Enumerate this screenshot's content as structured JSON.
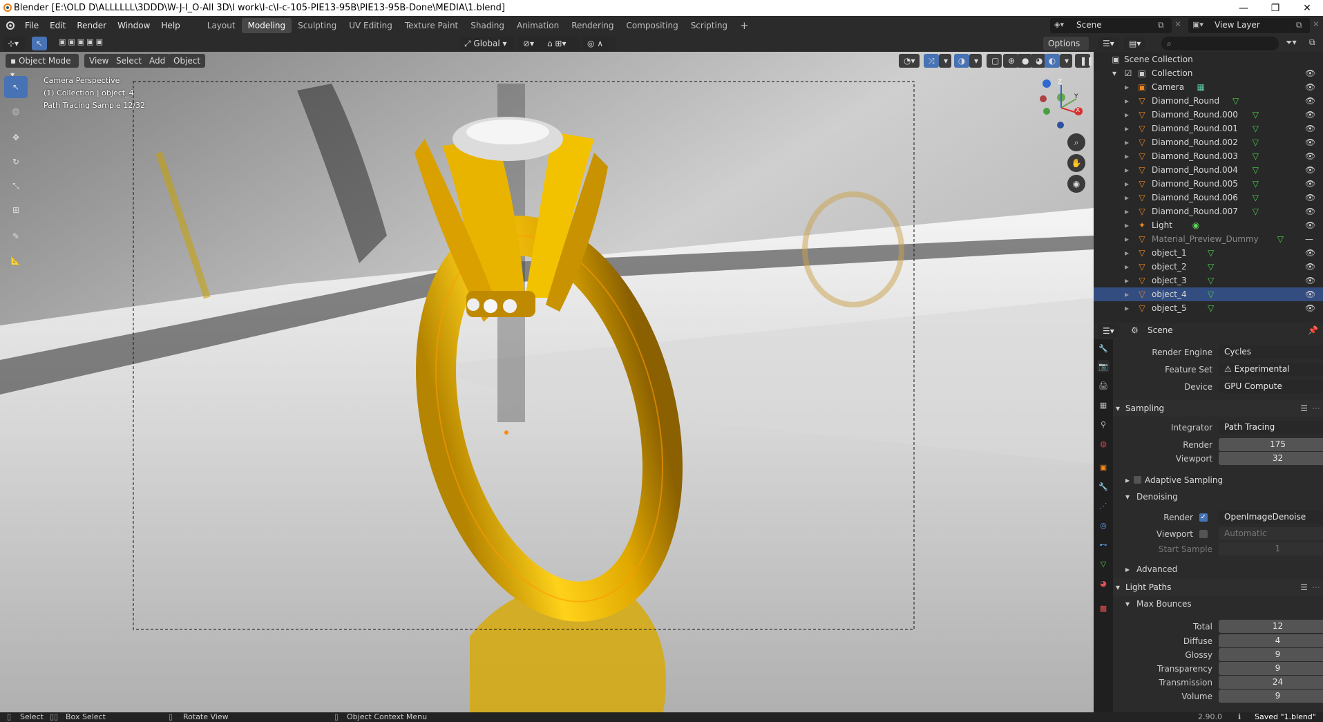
{
  "window": {
    "title": "Blender [E:\\OLD D\\ALLLLLL\\3DDD\\W-J-I_O-All 3D\\I work\\I-c\\I-c-105-PIE13-95B\\PIE13-95B-Done\\MEDIA\\1.blend]",
    "controls": [
      "—",
      "❐",
      "✕"
    ]
  },
  "menubar": {
    "menus": [
      "File",
      "Edit",
      "Render",
      "Window",
      "Help"
    ],
    "workspaces": [
      "Layout",
      "Modeling",
      "Sculpting",
      "UV Editing",
      "Texture Paint",
      "Shading",
      "Animation",
      "Rendering",
      "Compositing",
      "Scripting"
    ],
    "active_workspace": "Modeling",
    "add_tab": "+",
    "scene_label": "Scene",
    "view_layer_label": "View Layer"
  },
  "tool_header": {
    "transform_orientation": "Global",
    "options": "Options"
  },
  "view_header": {
    "mode": "Object Mode",
    "menus": [
      "View",
      "Select",
      "Add",
      "Object"
    ]
  },
  "viewport": {
    "info": [
      "Camera Perspective",
      "(1) Collection | object_4",
      "Path Tracing Sample 12/32"
    ],
    "gizmo": {
      "x": "X",
      "y": "Y",
      "z": "Z"
    }
  },
  "outliner": {
    "root": "Scene Collection",
    "collection": "Collection",
    "items": [
      {
        "name": "Camera",
        "type": "camera"
      },
      {
        "name": "Diamond_Round",
        "type": "mesh"
      },
      {
        "name": "Diamond_Round.000",
        "type": "mesh"
      },
      {
        "name": "Diamond_Round.001",
        "type": "mesh"
      },
      {
        "name": "Diamond_Round.002",
        "type": "mesh"
      },
      {
        "name": "Diamond_Round.003",
        "type": "mesh"
      },
      {
        "name": "Diamond_Round.004",
        "type": "mesh"
      },
      {
        "name": "Diamond_Round.005",
        "type": "mesh"
      },
      {
        "name": "Diamond_Round.006",
        "type": "mesh"
      },
      {
        "name": "Diamond_Round.007",
        "type": "mesh"
      },
      {
        "name": "Light",
        "type": "light"
      },
      {
        "name": "Material_Preview_Dummy",
        "type": "mesh",
        "dimmed": true
      },
      {
        "name": "object_1",
        "type": "mesh"
      },
      {
        "name": "object_2",
        "type": "mesh"
      },
      {
        "name": "object_3",
        "type": "mesh"
      },
      {
        "name": "object_4",
        "type": "mesh",
        "selected": true
      },
      {
        "name": "object_5",
        "type": "mesh"
      }
    ]
  },
  "properties": {
    "context": "Scene",
    "render_engine_label": "Render Engine",
    "render_engine": "Cycles",
    "feature_set_label": "Feature Set",
    "feature_set": "Experimental",
    "device_label": "Device",
    "device": "GPU Compute",
    "sampling": {
      "title": "Sampling",
      "integrator_label": "Integrator",
      "integrator": "Path Tracing",
      "render_label": "Render",
      "render": "175",
      "viewport_label": "Viewport",
      "viewport": "32",
      "adaptive": "Adaptive Sampling",
      "denoising": "Denoising",
      "den_render_label": "Render",
      "den_render": "OpenImageDenoise",
      "den_viewport_label": "Viewport",
      "den_viewport": "Automatic",
      "start_sample_label": "Start Sample",
      "start_sample": "1",
      "advanced": "Advanced"
    },
    "light_paths": {
      "title": "Light Paths",
      "max_bounces": "Max Bounces",
      "rows": [
        {
          "label": "Total",
          "value": "12"
        },
        {
          "label": "Diffuse",
          "value": "4"
        },
        {
          "label": "Glossy",
          "value": "9"
        },
        {
          "label": "Transparency",
          "value": "9"
        },
        {
          "label": "Transmission",
          "value": "24"
        },
        {
          "label": "Volume",
          "value": "9"
        }
      ]
    }
  },
  "statusbar": {
    "select": "Select",
    "box_select": "Box Select",
    "rotate": "Rotate View",
    "context_menu": "Object Context Menu",
    "version": "2.90.0",
    "saved": "Saved \"1.blend\""
  },
  "colors": {
    "accent": "#4772b3",
    "gold": "#e8b800",
    "selected_row": "#334d80"
  }
}
